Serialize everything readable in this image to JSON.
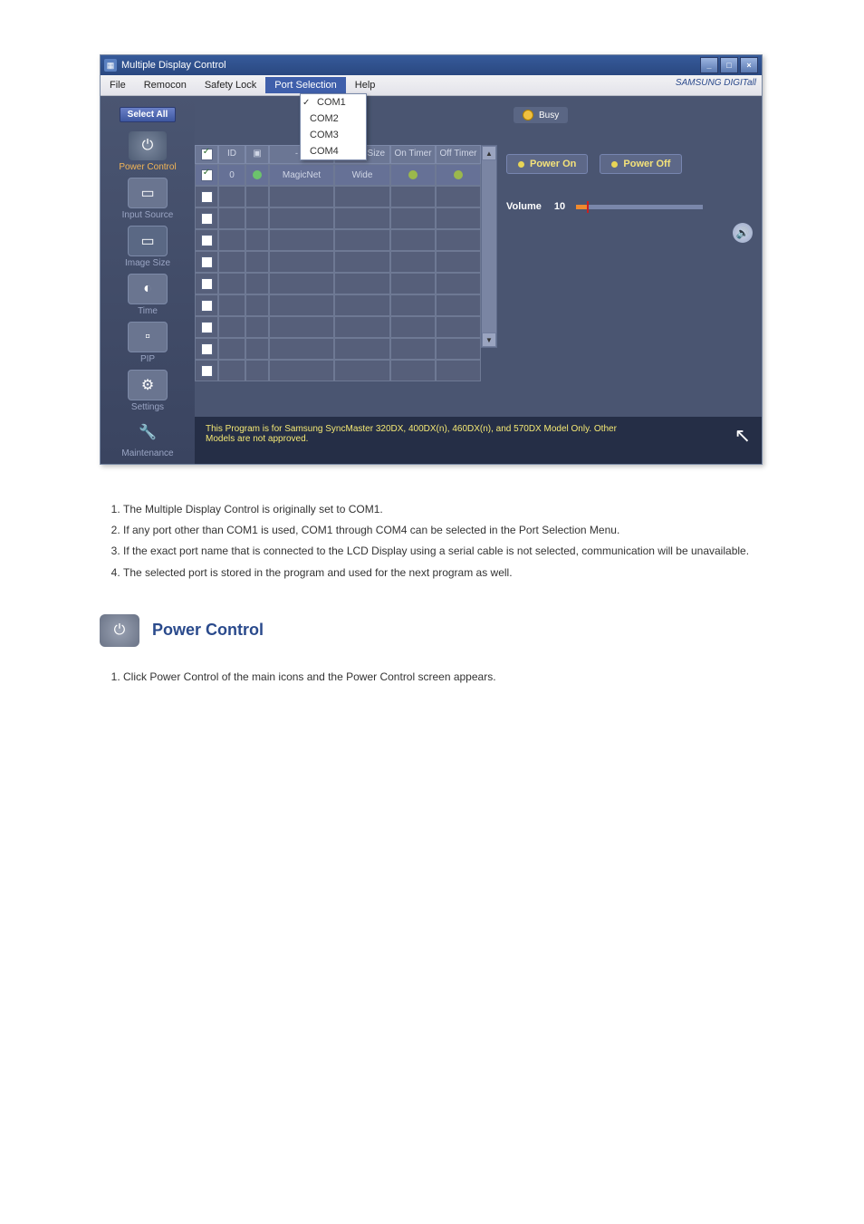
{
  "window": {
    "title": "Multiple Display Control"
  },
  "menu": {
    "file": "File",
    "remocon": "Remocon",
    "safety_lock": "Safety Lock",
    "port_selection": "Port Selection",
    "help": "Help",
    "brand": "SAMSUNG DIGITall"
  },
  "port_dropdown": {
    "items": [
      "COM1",
      "COM2",
      "COM3",
      "COM4"
    ]
  },
  "sidebar": {
    "select_all": "Select All",
    "items": [
      {
        "label": "Power Control"
      },
      {
        "label": "Input Source"
      },
      {
        "label": "Image Size"
      },
      {
        "label": "Time"
      },
      {
        "label": "PIP"
      },
      {
        "label": "Settings"
      },
      {
        "label": "Maintenance"
      }
    ]
  },
  "busy": "Busy",
  "grid": {
    "headers": {
      "id": "ID",
      "magicnet": "MagicNet",
      "image_size": "Image Size",
      "on_timer": "On Timer",
      "off_timer": "Off Timer"
    },
    "row0": {
      "id": "0",
      "magicnet": "MagicNet",
      "image_size": "Wide"
    }
  },
  "controls": {
    "power_on": "Power On",
    "power_off": "Power Off",
    "volume_label": "Volume",
    "volume_value": "10"
  },
  "footer": {
    "line1": "This Program is for Samsung SyncMaster 320DX, 400DX(n), 460DX(n), and 570DX  Model Only. Other",
    "line2": "Models are not approved."
  },
  "notes": [
    "The Multiple Display Control is originally set to COM1.",
    "If any port other than COM1 is used, COM1 through COM4 can be selected in the Port Selection Menu.",
    "If the exact port name that is connected to the LCD Display using a serial cable is not selected, communication will be unavailable.",
    "The selected port is stored in the program and used for the next program as well."
  ],
  "section": {
    "title": "Power Control"
  },
  "sub_notes": [
    "Click Power Control of the main icons and the Power Control screen appears."
  ]
}
